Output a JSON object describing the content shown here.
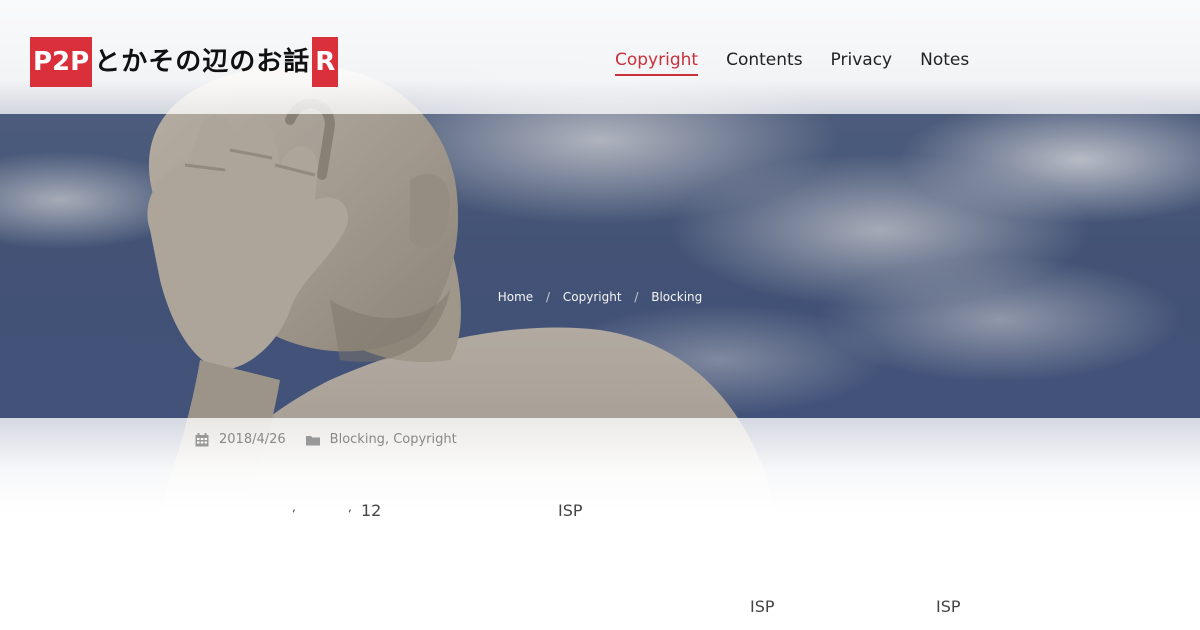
{
  "header": {
    "logo": {
      "badge_left": "P2P",
      "title": "とかその辺のお話",
      "badge_right": "R"
    },
    "nav": [
      {
        "label": "Copyright",
        "active": true
      },
      {
        "label": "Contents",
        "active": false
      },
      {
        "label": "Privacy",
        "active": false
      },
      {
        "label": "Notes",
        "active": false
      }
    ]
  },
  "breadcrumb": {
    "home": "Home",
    "section": "Copyright",
    "current": "Blocking",
    "separator": "/"
  },
  "post": {
    "date": "2018/4/26",
    "categories": {
      "first": "Blocking",
      "separator": ", ",
      "second": "Copyright"
    },
    "line1": {
      "comma1": ",",
      "comma2": ",",
      "number": "12",
      "isp": "ISP"
    },
    "line2": {
      "isp1": "ISP",
      "isp2": "ISP"
    }
  },
  "colors": {
    "accent": "#c8303b",
    "logo_red": "#d9303b",
    "sky": "#4a5b80"
  },
  "icons": {
    "date": "calendar-icon",
    "category": "folder-icon"
  }
}
